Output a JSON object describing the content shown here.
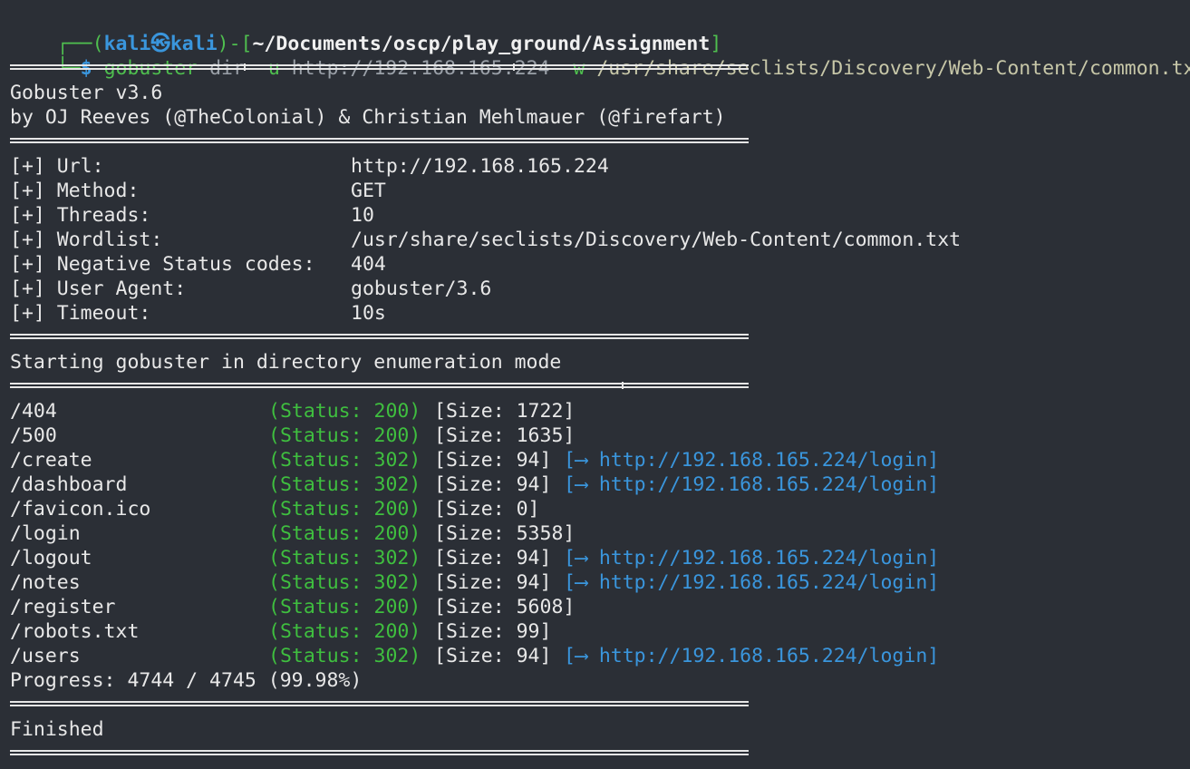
{
  "prompt": {
    "corner_top": "┌──(",
    "user": "kali",
    "at": "㉿",
    "host": "kali",
    "mid": ")-[",
    "cwd": "~/Documents/oscp/play_ground/Assignment",
    "close": "]",
    "corner_bottom": "└─",
    "dollar": "$"
  },
  "command": {
    "binary": "gobuster",
    "sub": "dir",
    "flag_u": "-u",
    "url": "http://192.168.165.224",
    "flag_w": "-w",
    "wordlist": "/usr/share/seclists/Discovery/Web-Content/common.txt"
  },
  "banner": {
    "version": "Gobuster v3.6",
    "authors": "by OJ Reeves (@TheColonial) & Christian Mehlmauer (@firefart)"
  },
  "config": [
    {
      "key": "[+] Url:",
      "value": "http://192.168.165.224"
    },
    {
      "key": "[+] Method:",
      "value": "GET"
    },
    {
      "key": "[+] Threads:",
      "value": "10"
    },
    {
      "key": "[+] Wordlist:",
      "value": "/usr/share/seclists/Discovery/Web-Content/common.txt"
    },
    {
      "key": "[+] Negative Status codes:",
      "value": "404"
    },
    {
      "key": "[+] User Agent:",
      "value": "gobuster/3.6"
    },
    {
      "key": "[+] Timeout:",
      "value": "10s"
    }
  ],
  "mode_message": "Starting gobuster in directory enumeration mode",
  "results": [
    {
      "path": "/404",
      "status": "(Status: 200)",
      "size": "[Size: 1722]",
      "redirect": ""
    },
    {
      "path": "/500",
      "status": "(Status: 200)",
      "size": "[Size: 1635]",
      "redirect": ""
    },
    {
      "path": "/create",
      "status": "(Status: 302)",
      "size": "[Size: 94]",
      "redirect": "[⟶ http://192.168.165.224/login]"
    },
    {
      "path": "/dashboard",
      "status": "(Status: 302)",
      "size": "[Size: 94]",
      "redirect": "[⟶ http://192.168.165.224/login]"
    },
    {
      "path": "/favicon.ico",
      "status": "(Status: 200)",
      "size": "[Size: 0]",
      "redirect": ""
    },
    {
      "path": "/login",
      "status": "(Status: 200)",
      "size": "[Size: 5358]",
      "redirect": ""
    },
    {
      "path": "/logout",
      "status": "(Status: 302)",
      "size": "[Size: 94]",
      "redirect": "[⟶ http://192.168.165.224/login]"
    },
    {
      "path": "/notes",
      "status": "(Status: 302)",
      "size": "[Size: 94]",
      "redirect": "[⟶ http://192.168.165.224/login]"
    },
    {
      "path": "/register",
      "status": "(Status: 200)",
      "size": "[Size: 5608]",
      "redirect": ""
    },
    {
      "path": "/robots.txt",
      "status": "(Status: 200)",
      "size": "[Size: 99]",
      "redirect": ""
    },
    {
      "path": "/users",
      "status": "(Status: 302)",
      "size": "[Size: 94]",
      "redirect": "[⟶ http://192.168.165.224/login]"
    }
  ],
  "progress": "Progress: 4744 / 4745 (99.98%)",
  "finished": "Finished",
  "colors": {
    "background": "#2b2f36",
    "status_green": "#3fbf3f",
    "link_blue": "#3a96dd"
  }
}
